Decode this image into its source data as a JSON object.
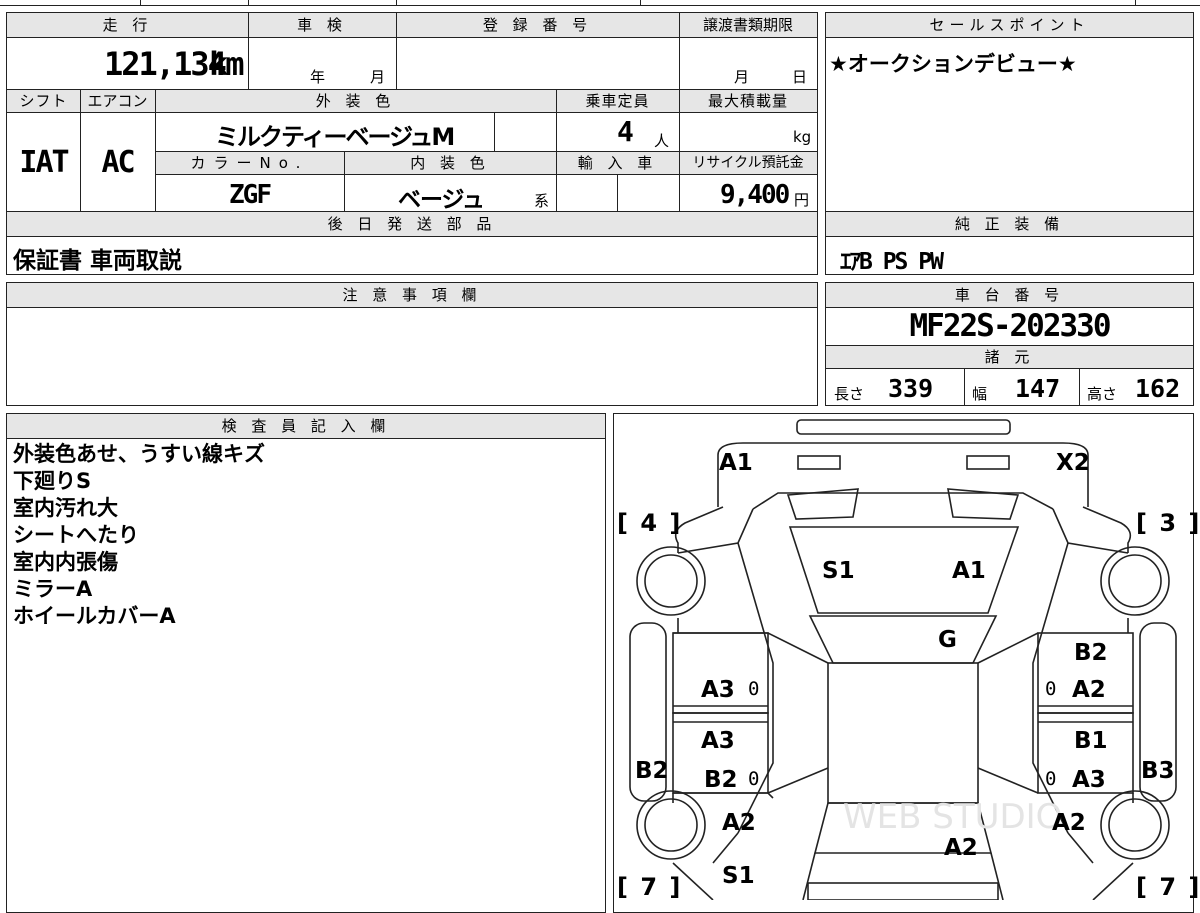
{
  "headers": {
    "mileage": "走 行",
    "inspection": "車 検",
    "registration": "登 録 番 号",
    "transfer_deadline": "譲渡書類期限",
    "sales_point": "セールスポイント",
    "shift": "シフト",
    "aircon": "エアコン",
    "exterior_color": "外 装 色",
    "capacity": "乗車定員",
    "max_load": "最大積載量",
    "color_no": "カラーNo.",
    "interior_color": "内 装 色",
    "import": "輸 入 車",
    "recycle": "リサイクル預託金",
    "later_parts": "後 日 発 送 部 品",
    "genuine_equipment": "純 正 装 備",
    "notes": "注 意 事 項 欄",
    "chassis_no": "車 台 番 号",
    "specs": "諸 元",
    "inspector": "検 査 員 記 入 欄"
  },
  "values": {
    "mileage": "121,134",
    "mileage_unit": "km",
    "year_label": "年",
    "month_label": "月",
    "deadline_month": "月",
    "deadline_day": "日",
    "sales_point": "★オークションデビュー★",
    "shift": "IAT",
    "aircon": "AC",
    "exterior_color": "ミルクティーベージュM",
    "capacity": "4",
    "capacity_unit": "人",
    "max_load_unit": "kg",
    "color_no": "ZGF",
    "interior_color": "ベージュ",
    "interior_suffix": "系",
    "recycle": "9,400",
    "recycle_unit": "円",
    "later_parts": "保証書 車両取説",
    "genuine_equipment": "ｴｱB PS PW",
    "chassis_no": "MF22S-202330",
    "length_label": "長さ",
    "length": "339",
    "width_label": "幅",
    "width": "147",
    "height_label": "高さ",
    "height": "162"
  },
  "inspector_notes": [
    "外装色あせ、うすい線キズ",
    "下廻りS",
    "室内汚れ大",
    "シートへたり",
    "室内内張傷",
    "ミラーA",
    "ホイールカバーA"
  ],
  "diagram": {
    "front_left_code": "A1",
    "front_right_code": "X2",
    "bracket_fl": "[ 4 ]",
    "bracket_fr": "[ 3 ]",
    "bracket_rl": "[ 7 ]",
    "bracket_rr": "[ 7 ]",
    "hood_left": "S1",
    "hood_right": "A1",
    "windshield": "G",
    "fl_door": "A3",
    "fl_door_zero": "0",
    "fr_door_top": "B2",
    "fr_door": "A2",
    "fr_door_zero": "0",
    "rl_door_top": "A3",
    "rl_door": "B2",
    "rl_door_zero": "0",
    "rr_door_top": "B1",
    "rr_door": "A3",
    "rr_door_zero": "0",
    "left_side": "B2",
    "right_side": "B3",
    "rl_fender": "A2",
    "rr_fender": "A2",
    "roof_rear": "A2",
    "rear_left": "S1",
    "watermark": "WEB STUDIO"
  }
}
